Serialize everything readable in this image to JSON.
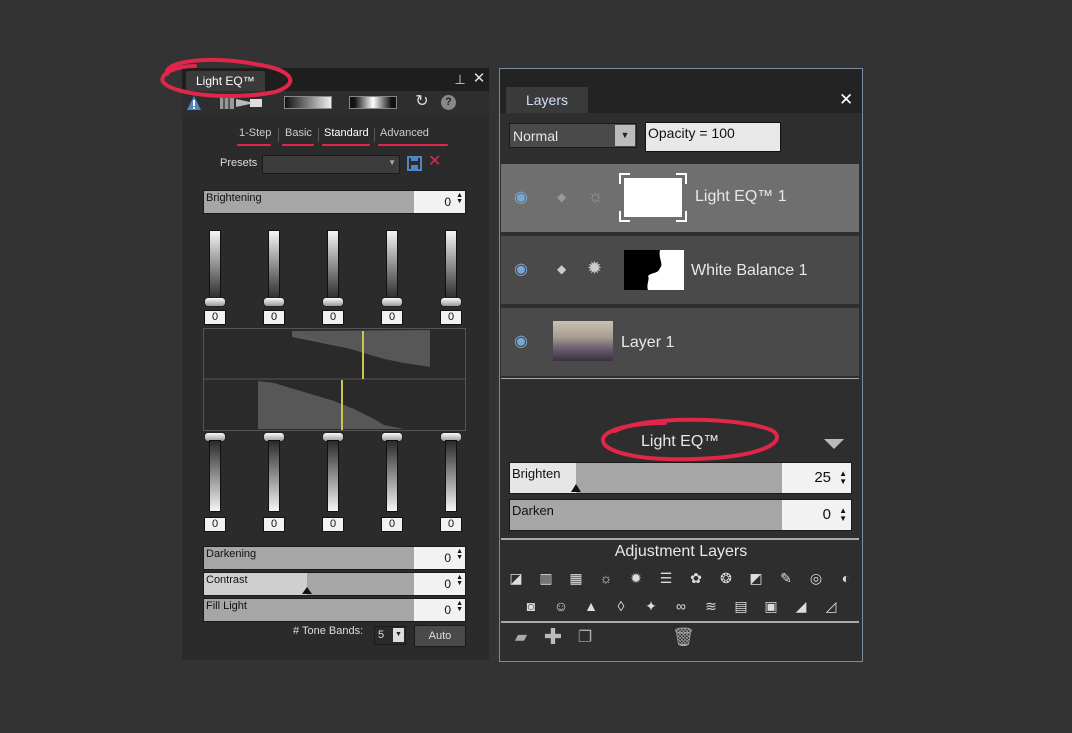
{
  "light_eq_panel": {
    "tab_title": "Light EQ™",
    "modes": [
      "1-Step",
      "Basic",
      "Standard",
      "Advanced"
    ],
    "presets_label": "Presets",
    "presets_value": "",
    "brightening_label": "Brightening",
    "brightening_value": "0",
    "top_bands": [
      "0",
      "0",
      "0",
      "0",
      "0"
    ],
    "bottom_bands": [
      "0",
      "0",
      "0",
      "0",
      "0"
    ],
    "darkening_label": "Darkening",
    "darkening_value": "0",
    "contrast_label": "Contrast",
    "contrast_value": "0",
    "fill_light_label": "Fill Light",
    "fill_light_value": "0",
    "tone_bands_label": "# Tone Bands:",
    "tone_bands_value": "5",
    "auto_label": "Auto"
  },
  "layers_panel": {
    "tab_title": "Layers",
    "blend_mode": "Normal",
    "opacity_text": "Opacity = 100",
    "layers": [
      {
        "name": "Light EQ™ 1",
        "selected": true
      },
      {
        "name": "White Balance 1",
        "selected": false
      },
      {
        "name": "Layer 1",
        "selected": false
      }
    ],
    "properties_title": "Light EQ™",
    "brighten_label": "Brighten",
    "brighten_value": "25",
    "darken_label": "Darken",
    "darken_value": "0",
    "adjustment_layers_title": "Adjustment Layers"
  },
  "colors": {
    "annotation_red": "#e0264a",
    "eye_blue": "#7aa8d6",
    "panel_border": "#7a8aa0"
  }
}
